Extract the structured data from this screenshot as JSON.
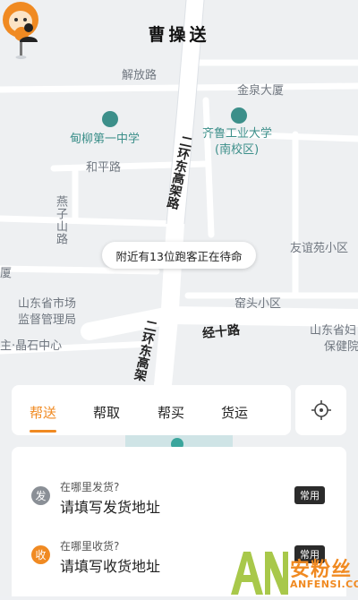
{
  "header": {
    "title": "曹操送"
  },
  "map": {
    "labels": {
      "jiefang_road": "解放路",
      "jinquan_tower": "金泉大厦",
      "qilu_university": "齐鲁工业大学",
      "south_campus": "(南校区)",
      "dianliu_school": "甸柳第一中学",
      "heping_road": "和平路",
      "erhuan_east_elevated": "二环东高架路",
      "erhuan_east_elevated_lower": "二环东高架",
      "yanzishan_road": "燕子山路",
      "youyiyuan": "友谊苑小区",
      "xia": "厦",
      "market_bureau_1": "山东省市场",
      "market_bureau_2": "监督管理局",
      "yaotou": "窑头小区",
      "jingshi_road": "经十路",
      "shandong_bao_1": "山东省妇",
      "shandong_bao_2": "保健院",
      "jingshi_center": "主·晶石中心"
    },
    "status_bubble": "附近有13位跑客正在待命"
  },
  "service_tabs": {
    "tabs": [
      "帮送",
      "帮取",
      "帮买",
      "货运"
    ],
    "active": "帮送"
  },
  "address": {
    "send": {
      "badge": "发",
      "question": "在哪里发货?",
      "placeholder": "请填写发货地址",
      "common_label": "常用"
    },
    "receive": {
      "badge": "收",
      "question": "在哪里收货?",
      "placeholder": "请填写收货地址",
      "common_label": "常用"
    }
  },
  "watermark": {
    "brand": "安粉丝",
    "domain": "ANFENSI.COM",
    "logo_text": "AN"
  },
  "colors": {
    "accent": "#f08a22",
    "green_poi": "#3c8f8a",
    "badge_dark": "#2b2b2b",
    "badge_gray": "#8a8f96"
  },
  "icons": {
    "user": "user-icon",
    "locate": "crosshair-icon",
    "school": "school-icon",
    "pin": "map-pin-icon"
  }
}
